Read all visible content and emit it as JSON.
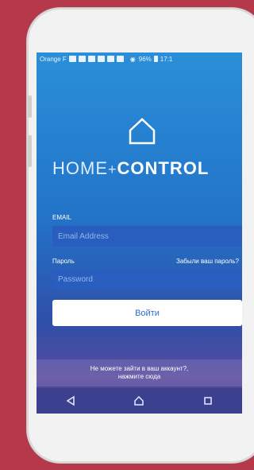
{
  "statusbar": {
    "carrier": "Orange F",
    "battery": "96%",
    "time": "17:1"
  },
  "brand": {
    "home": "HOME",
    "plus": "+",
    "control": "CONTROL"
  },
  "form": {
    "email_label": "EMAIL",
    "email_placeholder": "Email Address",
    "password_label": "Пароль",
    "forgot_link": "Забыли ваш пароль?",
    "password_placeholder": "Password",
    "signin_label": "Войти"
  },
  "help": {
    "line1": "Не можете зайти в ваш аккаунт?,",
    "line2": "нажмите сюда"
  },
  "navbar": {
    "icons": [
      "back-icon",
      "home-icon",
      "recents-icon"
    ]
  }
}
